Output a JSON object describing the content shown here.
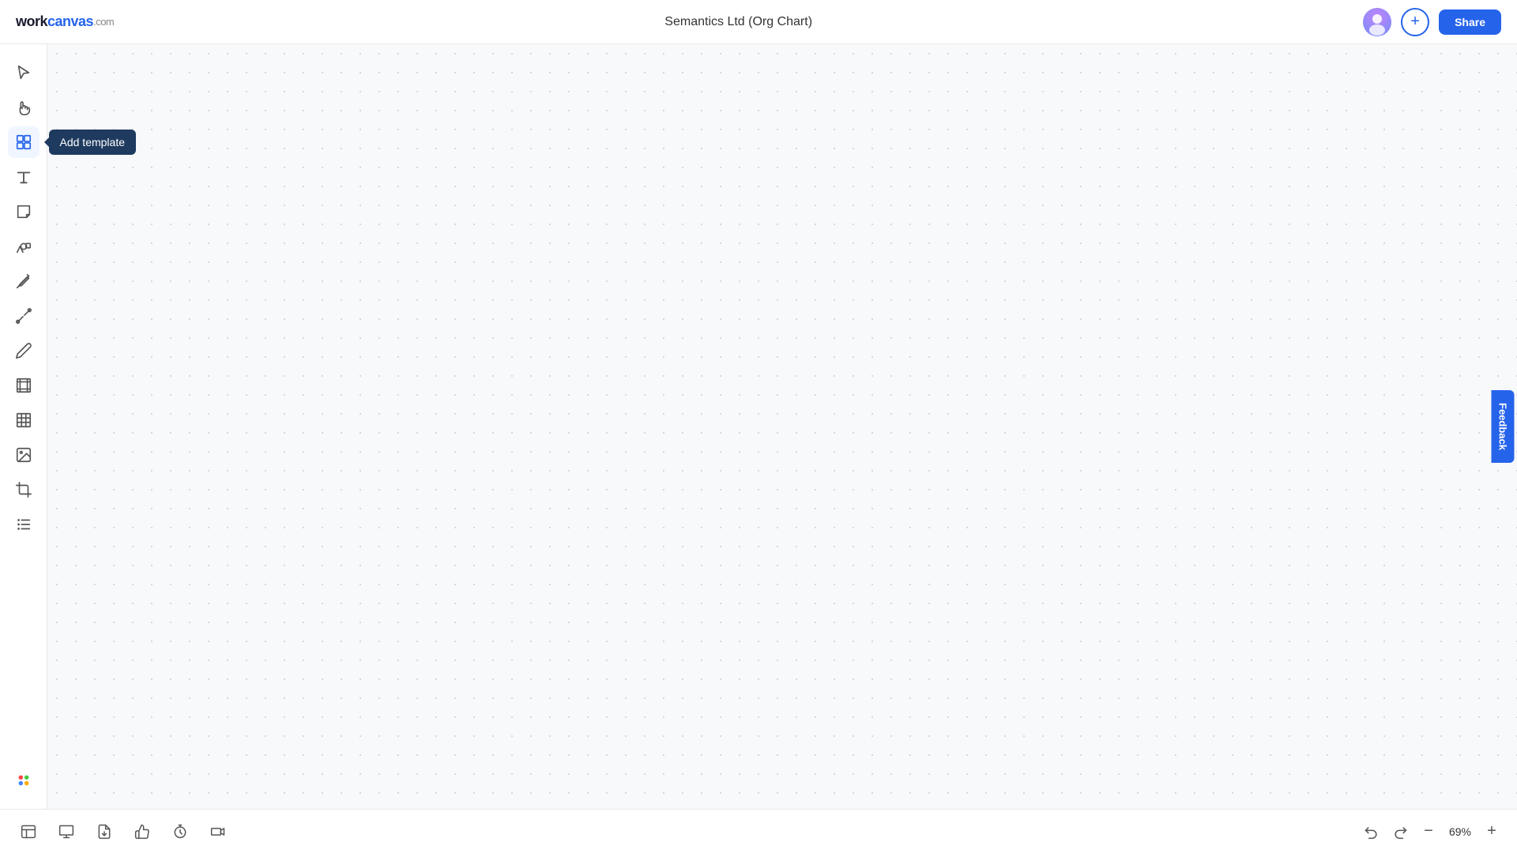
{
  "header": {
    "logo_work": "work",
    "logo_canvas": "canvas",
    "logo_com": ".com",
    "title": "Semantics Ltd (Org Chart)",
    "share_label": "Share"
  },
  "sidebar": {
    "tools": [
      {
        "id": "select",
        "name": "select-tool",
        "label": "Select"
      },
      {
        "id": "hand",
        "name": "hand-tool",
        "label": "Hand / Pan"
      },
      {
        "id": "template",
        "name": "template-tool",
        "label": "Add template",
        "active": true,
        "tooltip": "Add template"
      },
      {
        "id": "text",
        "name": "text-tool",
        "label": "Text"
      },
      {
        "id": "sticky",
        "name": "sticky-note-tool",
        "label": "Sticky note"
      },
      {
        "id": "shapes",
        "name": "shapes-tool",
        "label": "Shapes"
      },
      {
        "id": "pen",
        "name": "pen-tool",
        "label": "Pen"
      },
      {
        "id": "connector",
        "name": "connector-tool",
        "label": "Connector"
      },
      {
        "id": "pencil",
        "name": "pencil-tool",
        "label": "Pencil"
      },
      {
        "id": "frame",
        "name": "frame-tool",
        "label": "Frame"
      },
      {
        "id": "table",
        "name": "table-tool",
        "label": "Table"
      },
      {
        "id": "image",
        "name": "image-tool",
        "label": "Image"
      },
      {
        "id": "frame2",
        "name": "crop-tool",
        "label": "Crop"
      },
      {
        "id": "list",
        "name": "list-tool",
        "label": "List"
      },
      {
        "id": "apps",
        "name": "apps-tool",
        "label": "Apps"
      }
    ]
  },
  "tooltip": {
    "label": "Add template"
  },
  "bottom_bar": {
    "tools": [
      {
        "id": "panels",
        "name": "panels-tool",
        "label": "Panels"
      },
      {
        "id": "present",
        "name": "present-tool",
        "label": "Present"
      },
      {
        "id": "export",
        "name": "export-tool",
        "label": "Export"
      },
      {
        "id": "reactions",
        "name": "reactions-tool",
        "label": "Reactions"
      },
      {
        "id": "timer",
        "name": "timer-tool",
        "label": "Timer"
      },
      {
        "id": "video",
        "name": "video-tool",
        "label": "Video"
      }
    ],
    "zoom_level": "69%"
  },
  "feedback": {
    "label": "Feedback"
  }
}
